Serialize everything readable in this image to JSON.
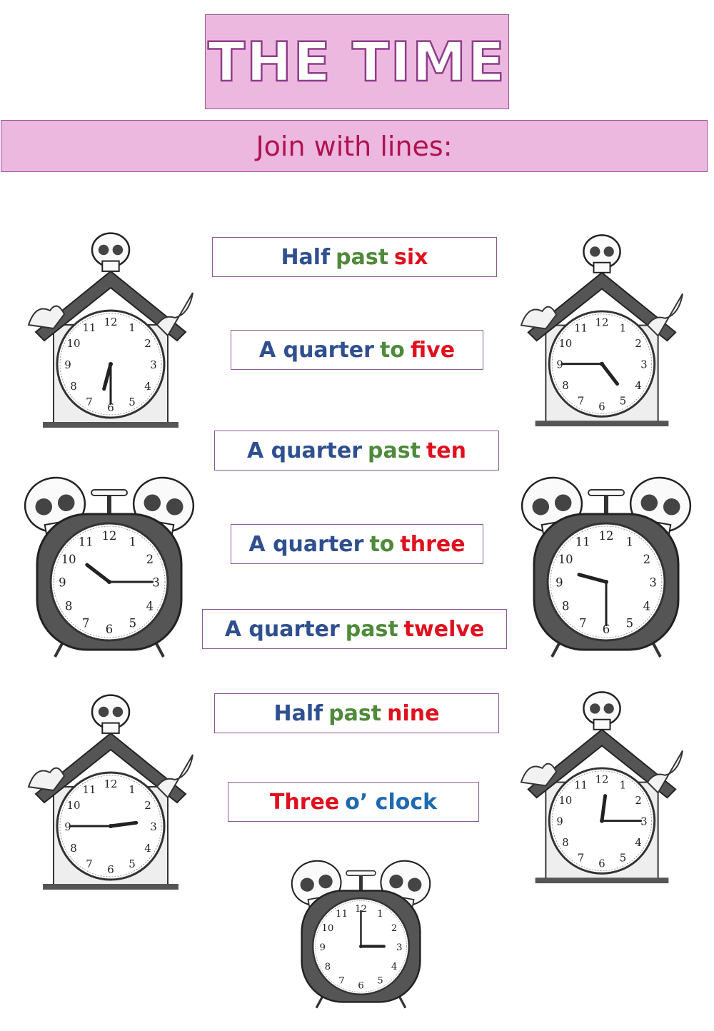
{
  "title": "THE TIME",
  "instruction": "Join with lines:",
  "colors": {
    "title_bg": "#ecb8e0",
    "title_stroke": "#8e3d8a",
    "instruction_text": "#b0124e",
    "blue": "#2f4f8f",
    "green": "#4f8a3a",
    "red": "#e0101e",
    "clock_blue": "#1e6ab0"
  },
  "labels": [
    {
      "parts": [
        {
          "text": "Half",
          "color": "blue"
        },
        {
          "text": "past",
          "color": "green"
        },
        {
          "text": "six",
          "color": "red"
        }
      ]
    },
    {
      "parts": [
        {
          "text": "A quarter",
          "color": "blue"
        },
        {
          "text": "to",
          "color": "green"
        },
        {
          "text": "five",
          "color": "red"
        }
      ]
    },
    {
      "parts": [
        {
          "text": "A quarter",
          "color": "blue"
        },
        {
          "text": "past",
          "color": "green"
        },
        {
          "text": "ten",
          "color": "red"
        }
      ]
    },
    {
      "parts": [
        {
          "text": "A quarter",
          "color": "blue"
        },
        {
          "text": "to",
          "color": "green"
        },
        {
          "text": "three",
          "color": "red"
        }
      ]
    },
    {
      "parts": [
        {
          "text": "A quarter",
          "color": "blue"
        },
        {
          "text": "past",
          "color": "green"
        },
        {
          "text": "twelve",
          "color": "red"
        }
      ]
    },
    {
      "parts": [
        {
          "text": "Half",
          "color": "blue"
        },
        {
          "text": "past",
          "color": "green"
        },
        {
          "text": "nine",
          "color": "red"
        }
      ]
    },
    {
      "parts": [
        {
          "text": "Three",
          "color": "red"
        },
        {
          "text": "o’ clock",
          "color": "clock_blue"
        }
      ]
    }
  ],
  "clocks": [
    {
      "style": "cuckoo",
      "hour": 6,
      "minute": 30
    },
    {
      "style": "cuckoo",
      "hour": 4,
      "minute": 45
    },
    {
      "style": "alarm",
      "hour": 10,
      "minute": 15
    },
    {
      "style": "alarm",
      "hour": 9,
      "minute": 30
    },
    {
      "style": "cuckoo",
      "hour": 2,
      "minute": 45
    },
    {
      "style": "cuckoo",
      "hour": 12,
      "minute": 15
    },
    {
      "style": "alarm",
      "hour": 3,
      "minute": 0
    }
  ],
  "dial_numbers": [
    "12",
    "1",
    "2",
    "3",
    "4",
    "5",
    "6",
    "7",
    "8",
    "9",
    "10",
    "11"
  ]
}
